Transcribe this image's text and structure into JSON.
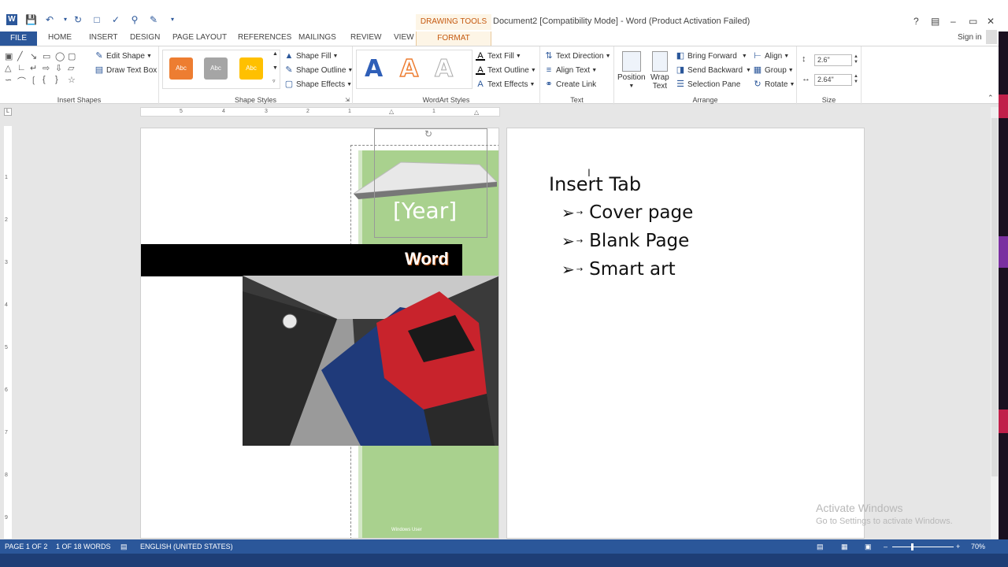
{
  "app": {
    "logo_label": "W"
  },
  "title": {
    "drawing_tools": "DRAWING TOOLS",
    "document": "Document2 [Compatibility Mode] - Word (Product Activation Failed)",
    "help": "?",
    "minimize": "–",
    "restore": "▭",
    "close": "✕"
  },
  "tabs": {
    "file": "FILE",
    "home": "HOME",
    "insert": "INSERT",
    "design": "DESIGN",
    "page_layout": "PAGE LAYOUT",
    "references": "REFERENCES",
    "mailings": "MAILINGS",
    "review": "REVIEW",
    "view": "VIEW",
    "format": "FORMAT",
    "sign_in": "Sign in"
  },
  "ribbon": {
    "insert_shapes": {
      "label": "Insert Shapes",
      "edit_shape": "Edit Shape",
      "draw_text_box": "Draw Text Box"
    },
    "shape_styles": {
      "label": "Shape Styles",
      "swatch_text": "Abc",
      "shape_fill": "Shape Fill",
      "shape_outline": "Shape Outline",
      "shape_effects": "Shape Effects",
      "colors": [
        "#ed7d31",
        "#a5a5a5",
        "#ffc000"
      ]
    },
    "wordart_styles": {
      "label": "WordArt Styles",
      "letter": "A",
      "text_fill": "Text Fill",
      "text_outline": "Text Outline",
      "text_effects": "Text Effects"
    },
    "text": {
      "label": "Text",
      "text_direction": "Text Direction",
      "align_text": "Align Text",
      "create_link": "Create Link"
    },
    "arrange": {
      "label": "Arrange",
      "position": "Position",
      "wrap": "Wrap",
      "wrap2": "Text",
      "bring_forward": "Bring Forward",
      "send_backward": "Send Backward",
      "selection_pane": "Selection Pane",
      "align": "Align",
      "group": "Group",
      "rotate": "Rotate"
    },
    "size": {
      "label": "Size",
      "height": "2.6\"",
      "width": "2.64\""
    }
  },
  "ruler": {
    "marks": [
      "5",
      "4",
      "3",
      "2",
      "1",
      "1"
    ]
  },
  "vruler": {
    "marks": [
      "1",
      "2",
      "3",
      "4",
      "5",
      "6",
      "7",
      "8",
      "9"
    ]
  },
  "page1": {
    "year": "[Year]",
    "title": "Word",
    "author": "Windows User"
  },
  "page2": {
    "heading": "Insert Tab",
    "bullets": [
      "Cover page",
      "Blank Page",
      "Smart art"
    ]
  },
  "status": {
    "page": "PAGE 1 OF 2",
    "words": "1 OF 18 WORDS",
    "language": "ENGLISH (UNITED STATES)",
    "zoom": "70%"
  },
  "watermark": {
    "line1": "Activate Windows",
    "line2": "Go to Settings to activate Windows."
  }
}
